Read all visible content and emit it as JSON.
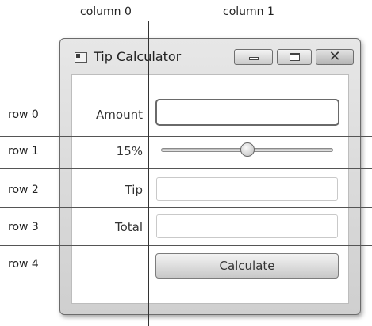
{
  "annotations": {
    "columns": [
      "column 0",
      "column 1"
    ],
    "rows": [
      "row 0",
      "row 1",
      "row 2",
      "row 3",
      "row 4"
    ]
  },
  "window": {
    "title": "Tip Calculator",
    "icons": {
      "app": "window-app-icon",
      "minimize": "minimize-icon",
      "maximize": "maximize-icon",
      "close": "close-icon"
    },
    "close_glyph": "✕"
  },
  "form": {
    "amount_label": "Amount",
    "amount_value": "",
    "percent_label": "15%",
    "tip_percent": 15,
    "tip_label": "Tip",
    "tip_value": "",
    "total_label": "Total",
    "total_value": "",
    "calculate_label": "Calculate"
  }
}
